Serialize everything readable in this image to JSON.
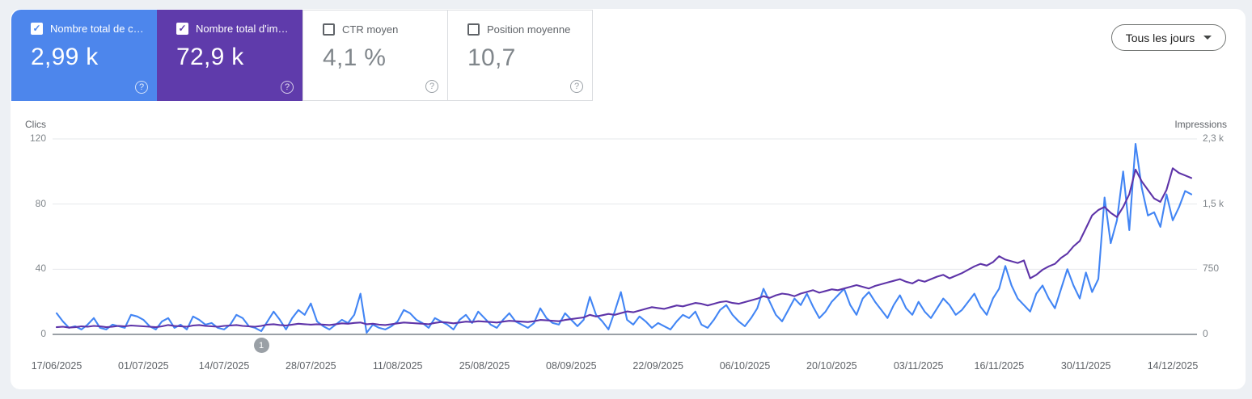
{
  "toolbar": {
    "date_filter_label": "Tous les jours"
  },
  "cards": [
    {
      "label": "Nombre total de c…",
      "value": "2,99 k",
      "checked": true,
      "color": "#4d86ec"
    },
    {
      "label": "Nombre total d'im…",
      "value": "72,9 k",
      "checked": true,
      "color": "#5f3bab"
    },
    {
      "label": "CTR moyen",
      "value": "4,1 %",
      "checked": false,
      "color": null
    },
    {
      "label": "Position moyenne",
      "value": "10,7",
      "checked": false,
      "color": null
    }
  ],
  "chart_data": {
    "type": "line",
    "axis_left_title": "Clics",
    "axis_right_title": "Impressions",
    "ylim_left": [
      0,
      120
    ],
    "ylim_right": [
      0,
      2300
    ],
    "grid": true,
    "y_ticks": [
      {
        "left_label": "120",
        "right_label": "2,3 k",
        "clicks": 120
      },
      {
        "left_label": "80",
        "right_label": "1,5 k",
        "clicks": 80
      },
      {
        "left_label": "40",
        "right_label": "750",
        "clicks": 40
      },
      {
        "left_label": "0",
        "right_label": "0",
        "clicks": 0
      }
    ],
    "x_ticks": [
      {
        "label": "17/06/2025",
        "day": 0
      },
      {
        "label": "01/07/2025",
        "day": 14
      },
      {
        "label": "14/07/2025",
        "day": 27
      },
      {
        "label": "28/07/2025",
        "day": 41
      },
      {
        "label": "11/08/2025",
        "day": 55
      },
      {
        "label": "25/08/2025",
        "day": 69
      },
      {
        "label": "08/09/2025",
        "day": 83
      },
      {
        "label": "22/09/2025",
        "day": 97
      },
      {
        "label": "06/10/2025",
        "day": 111
      },
      {
        "label": "20/10/2025",
        "day": 125
      },
      {
        "label": "03/11/2025",
        "day": 139
      },
      {
        "label": "16/11/2025",
        "day": 152
      },
      {
        "label": "30/11/2025",
        "day": 166
      },
      {
        "label": "14/12/2025",
        "day": 180
      }
    ],
    "annotation": {
      "label": "1",
      "day_index": 33
    },
    "series": [
      {
        "name": "Clics",
        "axis": "left",
        "color": "#4285f4",
        "values": [
          13,
          8,
          4,
          5,
          3,
          6,
          10,
          4,
          3,
          6,
          5,
          4,
          12,
          11,
          9,
          5,
          3,
          8,
          10,
          4,
          6,
          3,
          11,
          9,
          6,
          7,
          4,
          3,
          6,
          12,
          10,
          5,
          4,
          2,
          8,
          14,
          9,
          3,
          10,
          15,
          12,
          19,
          8,
          5,
          3,
          6,
          9,
          7,
          12,
          25,
          1,
          6,
          4,
          3,
          5,
          8,
          15,
          13,
          9,
          7,
          4,
          10,
          8,
          6,
          3,
          9,
          12,
          7,
          14,
          10,
          6,
          4,
          9,
          13,
          8,
          6,
          4,
          7,
          16,
          10,
          7,
          6,
          13,
          9,
          5,
          9,
          23,
          12,
          8,
          3,
          14,
          26,
          9,
          6,
          11,
          8,
          4,
          7,
          5,
          3,
          8,
          12,
          10,
          14,
          6,
          4,
          9,
          15,
          18,
          12,
          8,
          5,
          10,
          16,
          28,
          20,
          12,
          8,
          15,
          22,
          18,
          25,
          17,
          10,
          14,
          20,
          24,
          28,
          18,
          12,
          22,
          26,
          20,
          15,
          10,
          18,
          24,
          16,
          12,
          20,
          14,
          10,
          16,
          22,
          18,
          12,
          15,
          20,
          25,
          17,
          12,
          22,
          28,
          42,
          30,
          22,
          18,
          14,
          25,
          30,
          22,
          16,
          28,
          40,
          30,
          22,
          38,
          26,
          34,
          84,
          56,
          70,
          100,
          64,
          117,
          90,
          73,
          75,
          66,
          86,
          70,
          78,
          88,
          86
        ]
      },
      {
        "name": "Impressions",
        "axis": "right",
        "color": "#5e34a8",
        "values": [
          85,
          90,
          80,
          85,
          95,
          90,
          100,
          95,
          85,
          90,
          100,
          95,
          105,
          100,
          95,
          90,
          85,
          95,
          110,
          100,
          95,
          90,
          105,
          110,
          100,
          95,
          90,
          100,
          105,
          110,
          100,
          95,
          90,
          100,
          115,
          120,
          110,
          105,
          115,
          125,
          120,
          115,
          120,
          115,
          110,
          120,
          130,
          125,
          135,
          140,
          120,
          125,
          115,
          110,
          120,
          130,
          140,
          135,
          130,
          125,
          120,
          135,
          145,
          140,
          130,
          140,
          150,
          145,
          155,
          150,
          145,
          140,
          150,
          160,
          155,
          150,
          145,
          155,
          170,
          165,
          160,
          155,
          170,
          180,
          190,
          200,
          230,
          210,
          225,
          240,
          230,
          250,
          270,
          260,
          280,
          300,
          320,
          310,
          300,
          320,
          340,
          330,
          350,
          370,
          360,
          340,
          360,
          380,
          390,
          370,
          360,
          380,
          400,
          420,
          450,
          430,
          460,
          480,
          470,
          450,
          480,
          500,
          520,
          490,
          510,
          530,
          520,
          540,
          560,
          580,
          560,
          540,
          570,
          590,
          610,
          630,
          650,
          620,
          600,
          640,
          620,
          650,
          680,
          700,
          660,
          690,
          720,
          760,
          800,
          830,
          810,
          850,
          920,
          880,
          860,
          840,
          870,
          660,
          700,
          760,
          800,
          830,
          900,
          950,
          1036,
          1100,
          1250,
          1400,
          1464,
          1500,
          1430,
          1380,
          1500,
          1650,
          1940,
          1800,
          1700,
          1600,
          1560,
          1700,
          1955,
          1900,
          1870,
          1840
        ]
      }
    ]
  }
}
